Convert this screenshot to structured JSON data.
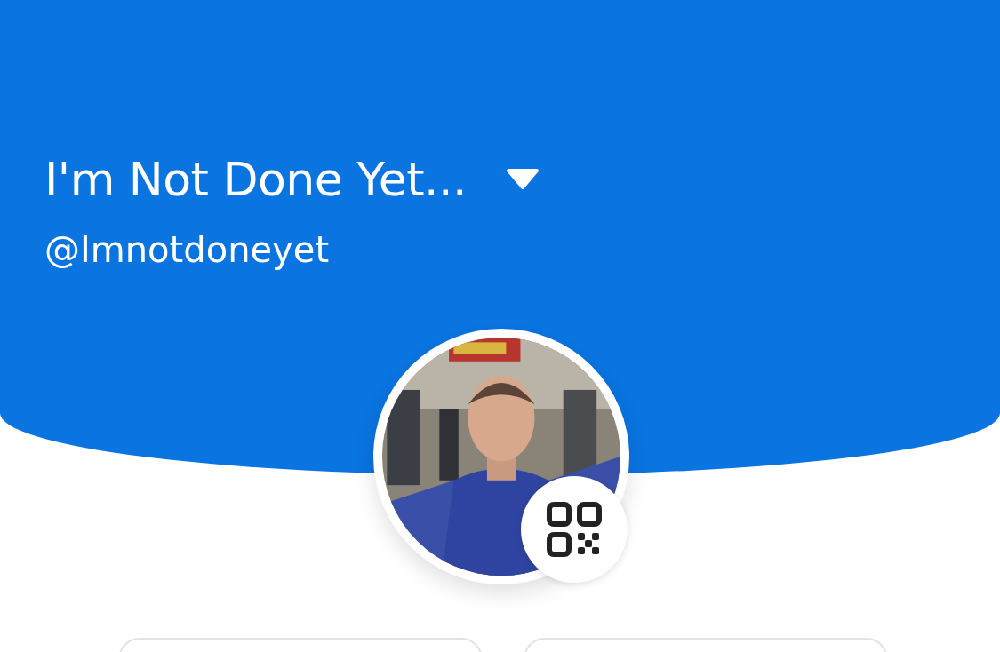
{
  "profile": {
    "title": "I'm Not Done Yet...",
    "handle": "@Imnotdoneyet"
  }
}
